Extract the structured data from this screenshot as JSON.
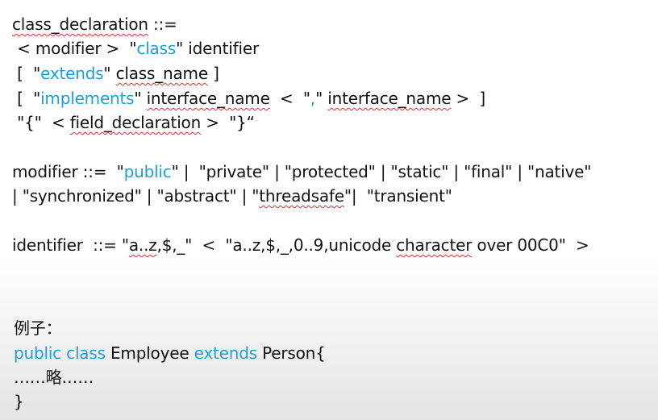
{
  "colors": {
    "keyword": "#1aa0e0",
    "text": "#111111",
    "spell_underline": "#d53030"
  },
  "class_decl": {
    "head": "class_declaration",
    "op": " ::=",
    "l2_open": " < modifier >  \"",
    "l2_kw": "class",
    "l2_close": "\" identifier",
    "l3_open": " [  \"",
    "l3_kw": "extends",
    "l3_q": "\" ",
    "l3_name": "class_name",
    "l3_close": " ]",
    "l4_open": " [  \"",
    "l4_kw": "implements",
    "l4_q": "\" ",
    "l4_name1": "interface_name",
    "l4_mid": "  <  \"",
    "l4_comma": ",",
    "l4_q2": "\" ",
    "l4_name2": "interface_name",
    "l4_close": " >  ]",
    "l5_open": " \"{\"  < ",
    "l5_name": "field_declaration",
    "l5_close": " >  \"}“"
  },
  "modifier": {
    "pre": "modifier ::=  \"",
    "kw": "public",
    "rest1": "\" |  \"private\" | \"protected\" | \"static\" | \"final\" | \"native\"",
    "line2_pre": "| \"synchronized\" | \"abstract\" | \"",
    "threadsafe": "threadsafe",
    "line2_post": "\"|  \"transient\""
  },
  "identifier": {
    "label": "identifier",
    "mid": "  ::= \"",
    "range1": "a..z",
    "rest1": ",$,_\"  <  \"a..z,$,_,0..9,unicode ",
    "character": "character",
    "rest2": " over 00C0\"  >"
  },
  "example": {
    "title": "例子：",
    "kw1": "public",
    "kw2": "class",
    "name": " Employee ",
    "kw3": "extends",
    "parent": " Person{",
    "body": "……略……",
    "close": "}"
  }
}
